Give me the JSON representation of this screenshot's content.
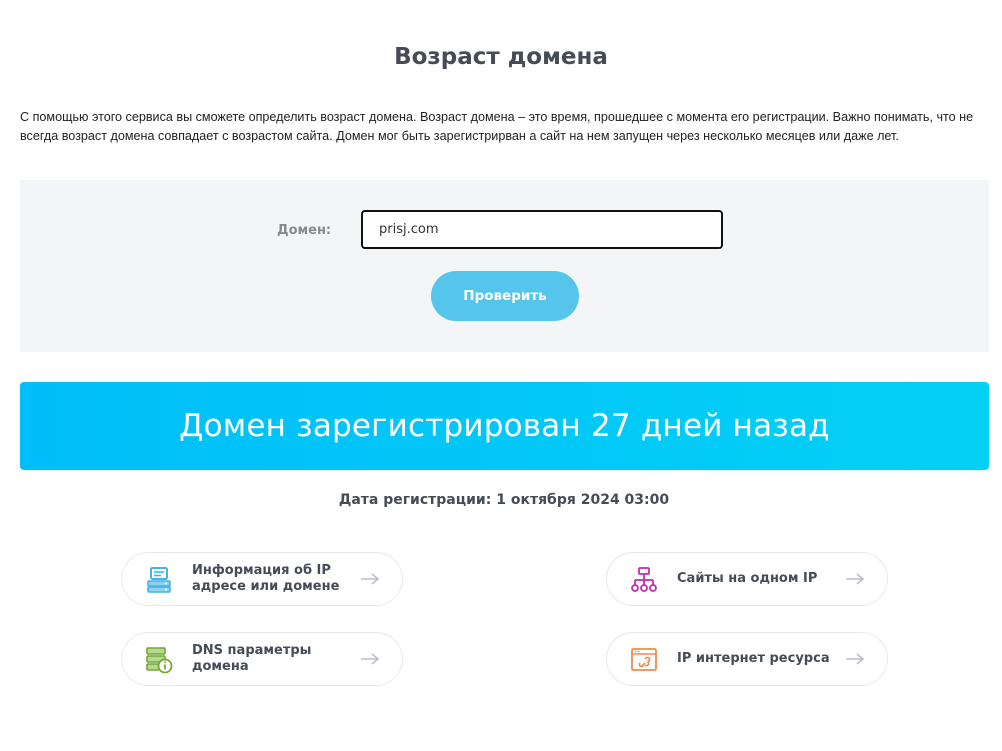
{
  "page": {
    "title": "Возраст домена",
    "intro": "С помощью этого сервиса вы сможете определить возраст домена. Возраст домена – это время, прошедшее с момента его регистрации. Важно понимать, что не всегда возраст домена совпадает с возрастом сайта. Домен мог быть зарегистрирван а сайт на нем запущен через несколько месяцев или даже лет."
  },
  "form": {
    "domain_label": "Домен:",
    "domain_value": "prisj.com",
    "check_button": "Проверить"
  },
  "result": {
    "banner_text": "Домен зарегистрирован 27 дней назад",
    "registration_date": "Дата регистрации: 1 октября 2024 03:00"
  },
  "tools": [
    {
      "label": "Информация об IP адресе или домене",
      "icon": "server-info-icon",
      "color": "#46b3e6"
    },
    {
      "label": "Сайты на одном IP",
      "icon": "network-tree-icon",
      "color": "#c32ab8"
    },
    {
      "label": "DNS параметры домена",
      "icon": "dns-info-icon",
      "color": "#72a83a"
    },
    {
      "label": "IP интернет ресурса",
      "icon": "browser-link-icon",
      "color": "#f08a4b"
    }
  ],
  "colors": {
    "accent": "#00c3f9",
    "button": "#55c5ec",
    "title": "#454c56",
    "panel_bg": "#f3f5f6"
  }
}
